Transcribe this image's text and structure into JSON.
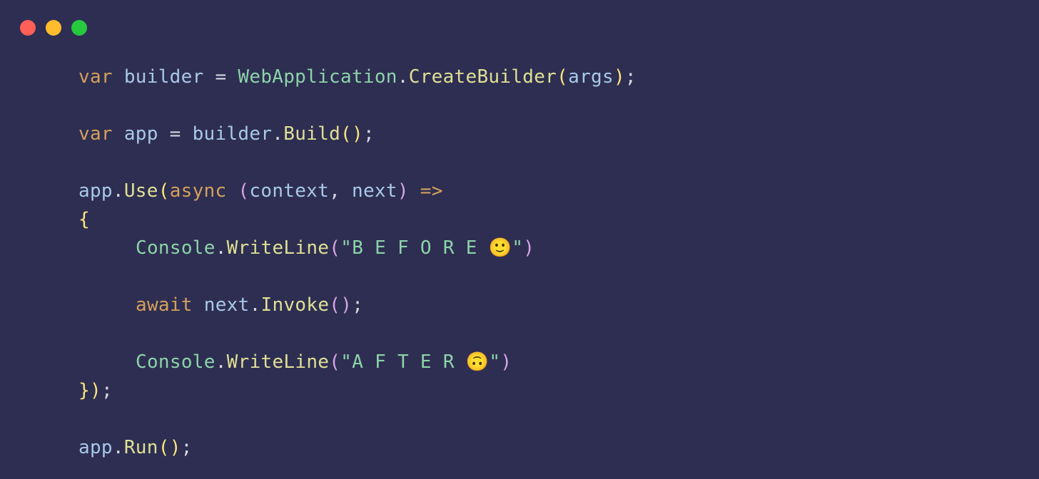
{
  "traffic_lights": {
    "red": "#ff5f56",
    "yellow": "#ffbd2e",
    "green": "#27c93f"
  },
  "code": {
    "line1": {
      "kw_var": "var",
      "sp": " ",
      "var_builder": "builder",
      "assign": " = ",
      "type": "WebApplication",
      "dot": ".",
      "method": "CreateBuilder",
      "lparen": "(",
      "arg": "args",
      "rparen": ")",
      "semi": ";"
    },
    "line2": {
      "kw_var": "var",
      "sp": " ",
      "var_app": "app",
      "assign": " = ",
      "var_builder": "builder",
      "dot": ".",
      "method": "Build",
      "lparen": "(",
      "rparen": ")",
      "semi": ";"
    },
    "line3": {
      "var_app": "app",
      "dot": ".",
      "method": "Use",
      "lparen": "(",
      "kw_async": "async",
      "sp": " ",
      "lparen2": "(",
      "p_context": "context",
      "comma": ", ",
      "p_next": "next",
      "rparen2": ")",
      "sp2": " ",
      "arrow": "=>"
    },
    "line4": {
      "lbrace": "{"
    },
    "line5": {
      "type": "Console",
      "dot": ".",
      "method": "WriteLine",
      "lparen": "(",
      "str_open": "\"",
      "str_text": "B E F O R E 🙂",
      "str_close": "\"",
      "rparen": ")"
    },
    "line6": {
      "kw_await": "await",
      "sp": " ",
      "var_next": "next",
      "dot": ".",
      "method": "Invoke",
      "lparen": "(",
      "rparen": ")",
      "semi": ";"
    },
    "line7": {
      "type": "Console",
      "dot": ".",
      "method": "WriteLine",
      "lparen": "(",
      "str_open": "\"",
      "str_text": "A F T E R 🙃",
      "str_close": "\"",
      "rparen": ")"
    },
    "line8": {
      "rbrace": "}",
      "rparen": ")",
      "semi": ";"
    },
    "line9": {
      "var_app": "app",
      "dot": ".",
      "method": "Run",
      "lparen": "(",
      "rparen": ")",
      "semi": ";"
    }
  }
}
